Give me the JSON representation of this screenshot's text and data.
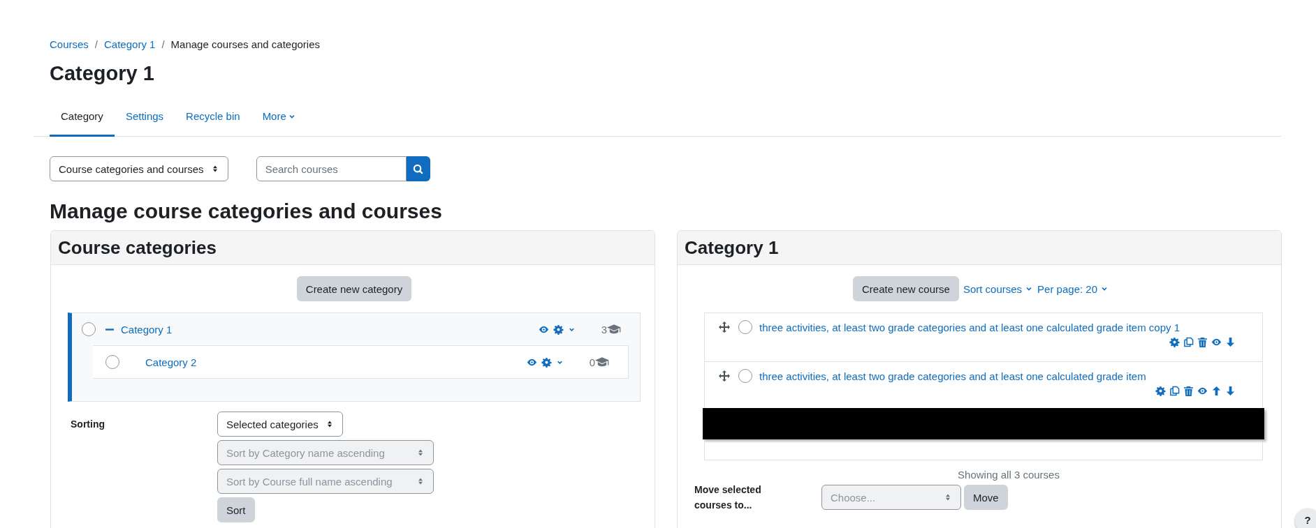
{
  "breadcrumb": [
    {
      "label": "Courses",
      "link": true
    },
    {
      "separator": "/",
      "label": "Category 1",
      "link": true
    },
    {
      "separator": "/",
      "label": "Manage courses and categories",
      "link": false
    }
  ],
  "page_title": "Category 1",
  "tabs": [
    {
      "label": "Category",
      "selected": true,
      "dropdown": false
    },
    {
      "label": "Settings",
      "selected": false,
      "dropdown": false
    },
    {
      "label": "Recycle bin",
      "selected": false,
      "dropdown": false
    },
    {
      "label": "More",
      "selected": false,
      "dropdown": true
    }
  ],
  "view_select": {
    "value": "Course categories and courses"
  },
  "search": {
    "placeholder": "Search courses"
  },
  "heading": "Manage course categories and courses",
  "categories_panel": {
    "title": "Course categories",
    "create_button": "Create new category",
    "categories": [
      {
        "name": "Category 1",
        "checked": false,
        "selected": true,
        "expanded": true,
        "course_count": "3",
        "children": [
          {
            "name": "Category 2",
            "checked": false,
            "selected": false,
            "course_count": "0"
          }
        ]
      }
    ],
    "sorting": {
      "label": "Sorting",
      "scope_select": "Selected categories",
      "selects": [
        {
          "value": "Sort by Category name ascending",
          "disabled": true
        },
        {
          "value": "Sort by Course full name ascending",
          "disabled": true
        }
      ],
      "button": "Sort"
    }
  },
  "courses_panel": {
    "title": "Category 1",
    "create_button": "Create new course",
    "sort_link": "Sort courses",
    "per_page_link": "Per page: 20",
    "courses": [
      {
        "name": "three activities, at least two grade categories and at least one calculated grade item copy 1",
        "checked": false,
        "can_move_up": false
      },
      {
        "name": "three activities, at least two grade categories and at least one calculated grade item",
        "checked": false,
        "can_move_up": true
      }
    ],
    "redaction_block": true,
    "showing": "Showing all 3 courses",
    "move": {
      "label": "Move selected courses to...",
      "placeholder": "Choose...",
      "disabled": true,
      "button": "Move"
    }
  },
  "help_button": "?"
}
